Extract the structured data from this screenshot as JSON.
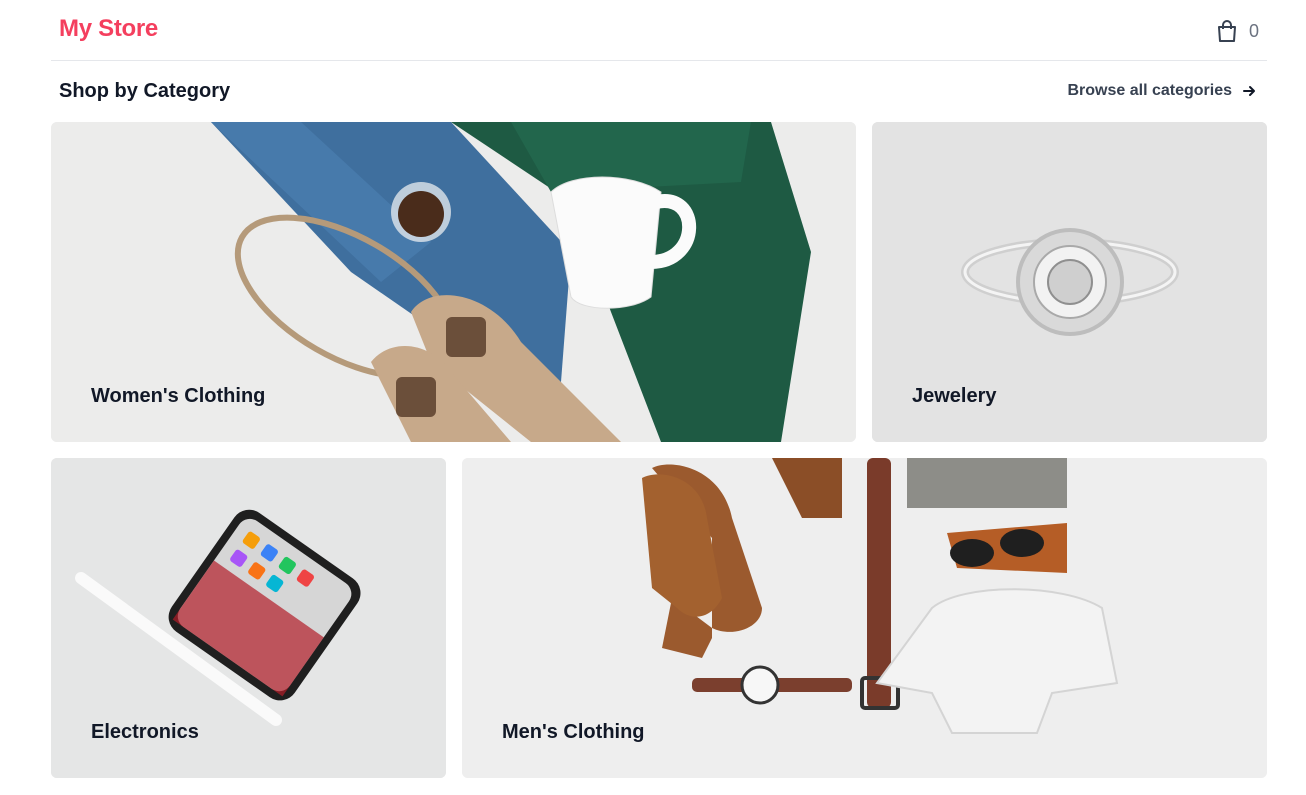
{
  "store": {
    "name": "My Store"
  },
  "cart": {
    "count": "0",
    "icon": "shopping-bag-icon"
  },
  "section": {
    "title": "Shop by Category",
    "browse_label": "Browse all categories",
    "browse_icon": "arrow-right-icon"
  },
  "categories": [
    {
      "label": "Women's Clothing"
    },
    {
      "label": "Jewelery"
    },
    {
      "label": "Electronics"
    },
    {
      "label": "Men's Clothing"
    }
  ],
  "colors": {
    "brand": "#f43f5e",
    "text": "#111827",
    "muted": "#6b7280",
    "divider": "#e5e7eb"
  }
}
